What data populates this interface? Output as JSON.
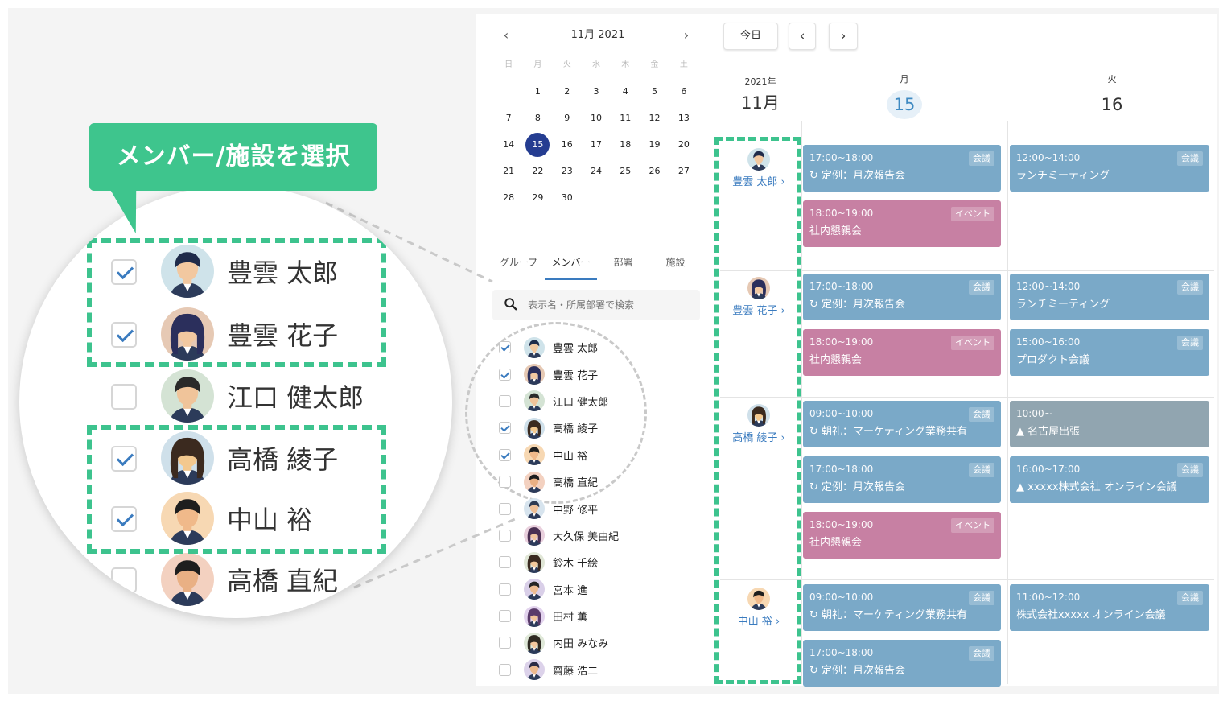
{
  "callout": {
    "label": "メンバー/施設を選択"
  },
  "mini_calendar": {
    "title": "11月 2021",
    "prev": "<",
    "next": ">",
    "weekdays": [
      "日",
      "月",
      "火",
      "水",
      "木",
      "金",
      "土"
    ],
    "weeks": [
      [
        "",
        "1",
        "2",
        "3",
        "4",
        "5",
        "6"
      ],
      [
        "7",
        "8",
        "9",
        "10",
        "11",
        "12",
        "13"
      ],
      [
        "14",
        "15",
        "16",
        "17",
        "18",
        "19",
        "20"
      ],
      [
        "21",
        "22",
        "23",
        "24",
        "25",
        "26",
        "27"
      ],
      [
        "28",
        "29",
        "30",
        "",
        "",
        "",
        ""
      ]
    ],
    "selected_day": "15"
  },
  "tabs": [
    {
      "label": "グループ",
      "active": false
    },
    {
      "label": "メンバー",
      "active": true
    },
    {
      "label": "部署",
      "active": false
    },
    {
      "label": "施設",
      "active": false
    }
  ],
  "search": {
    "placeholder": "表示名・所属部署で検索"
  },
  "members": [
    {
      "name": "豊雲 太郎",
      "checked": true,
      "avatar": "male-avatar",
      "skin": "#f2c8a0",
      "hair": "#1f2b4a",
      "bg": "#cfe3ea"
    },
    {
      "name": "豊雲 花子",
      "checked": true,
      "avatar": "female-avatar",
      "skin": "#f2c8a0",
      "hair": "#2b2f5c",
      "bg": "#e6c9b4"
    },
    {
      "name": "江口 健太郎",
      "checked": false,
      "avatar": "male-avatar",
      "skin": "#f0c49a",
      "hair": "#2a2a2a",
      "bg": "#d4e3d4"
    },
    {
      "name": "高橋 綾子",
      "checked": true,
      "avatar": "female-avatar",
      "skin": "#f3c88e",
      "hair": "#3b2a1f",
      "bg": "#cfe0ea"
    },
    {
      "name": "中山 裕",
      "checked": true,
      "avatar": "male-avatar",
      "skin": "#f0b98a",
      "hair": "#1e1e1e",
      "bg": "#f7d8b3"
    },
    {
      "name": "高橋 直紀",
      "checked": false,
      "avatar": "male-avatar",
      "skin": "#e9b084",
      "hair": "#1e1e1e",
      "bg": "#f3d1c0"
    },
    {
      "name": "中野 修平",
      "checked": false,
      "avatar": "male-avatar",
      "skin": "#eebf96",
      "hair": "#2d3a52",
      "bg": "#d7e4ee"
    },
    {
      "name": "大久保 美由紀",
      "checked": false,
      "avatar": "female-avatar",
      "skin": "#f1c49e",
      "hair": "#4a2f52",
      "bg": "#e9d0dd"
    },
    {
      "name": "鈴木 千絵",
      "checked": false,
      "avatar": "female-avatar",
      "skin": "#f2c89a",
      "hair": "#3a2a20",
      "bg": "#e0e6d6"
    },
    {
      "name": "宮本 進",
      "checked": false,
      "avatar": "male-avatar",
      "skin": "#edbc92",
      "hair": "#252525",
      "bg": "#d9cfe8"
    },
    {
      "name": "田村 薫",
      "checked": false,
      "avatar": "female-avatar",
      "skin": "#f2c49b",
      "hair": "#5a3b6a",
      "bg": "#e3d4ee"
    },
    {
      "name": "内田 みなみ",
      "checked": false,
      "avatar": "female-avatar",
      "skin": "#f3c79d",
      "hair": "#2f2a22",
      "bg": "#dfe8d8"
    },
    {
      "name": "齋藤 浩二",
      "checked": false,
      "avatar": "male-avatar",
      "skin": "#ecb98e",
      "hair": "#2b2b45",
      "bg": "#dcd2ea"
    }
  ],
  "toolbar": {
    "today_label": "今日",
    "prev": "<",
    "next": ">"
  },
  "date_header": {
    "year": "2021年",
    "month": "11月",
    "days": [
      {
        "dow": "月",
        "date": "15",
        "today": true
      },
      {
        "dow": "火",
        "date": "16",
        "today": false
      }
    ]
  },
  "people_rows": [
    {
      "name": "豊雲 太郎 ›",
      "mon": [
        {
          "time": "17:00~18:00",
          "tag": "会議",
          "title": "↻ 定例：月次報告会",
          "color": "blue"
        },
        {
          "time": "18:00~19:00",
          "tag": "イベント",
          "title": "社内懇親会",
          "color": "pink"
        }
      ],
      "tue": [
        {
          "time": "12:00~14:00",
          "tag": "会議",
          "title": "ランチミーティング",
          "color": "blue"
        }
      ]
    },
    {
      "name": "豊雲 花子 ›",
      "mon": [
        {
          "time": "17:00~18:00",
          "tag": "会議",
          "title": "↻ 定例：月次報告会",
          "color": "blue"
        },
        {
          "time": "18:00~19:00",
          "tag": "イベント",
          "title": "社内懇親会",
          "color": "pink"
        }
      ],
      "tue": [
        {
          "time": "12:00~14:00",
          "tag": "会議",
          "title": "ランチミーティング",
          "color": "blue"
        },
        {
          "time": "15:00~16:00",
          "tag": "会議",
          "title": "プロダクト会議",
          "color": "blue"
        }
      ]
    },
    {
      "name": "高橋 綾子 ›",
      "mon": [
        {
          "time": "09:00~10:00",
          "tag": "会議",
          "title": "↻ 朝礼：マーケティング業務共有",
          "color": "blue"
        },
        {
          "time": "17:00~18:00",
          "tag": "会議",
          "title": "↻ 定例：月次報告会",
          "color": "blue"
        },
        {
          "time": "18:00~19:00",
          "tag": "イベント",
          "title": "社内懇親会",
          "color": "pink"
        }
      ],
      "tue": [
        {
          "time": "10:00~",
          "tag": "",
          "title": "▲ 名古屋出張",
          "color": "gray"
        },
        {
          "time": "16:00~17:00",
          "tag": "会議",
          "title": "▲ xxxxx株式会社 オンライン会議",
          "color": "blue"
        }
      ]
    },
    {
      "name": "中山 裕 ›",
      "mon": [
        {
          "time": "09:00~10:00",
          "tag": "会議",
          "title": "↻ 朝礼：マーケティング業務共有",
          "color": "blue"
        },
        {
          "time": "17:00~18:00",
          "tag": "会議",
          "title": "↻ 定例：月次報告会",
          "color": "blue"
        }
      ],
      "tue": [
        {
          "time": "11:00~12:00",
          "tag": "会議",
          "title": "株式会社xxxxx オンライン会議",
          "color": "blue"
        }
      ]
    }
  ],
  "colors": {
    "accent_green": "#3ec58d",
    "today_circle": "#253d91",
    "event_blue": "#7aa9c8",
    "event_pink": "#c780a3",
    "event_gray": "#91a5b0",
    "link_blue": "#3a7bbf"
  }
}
